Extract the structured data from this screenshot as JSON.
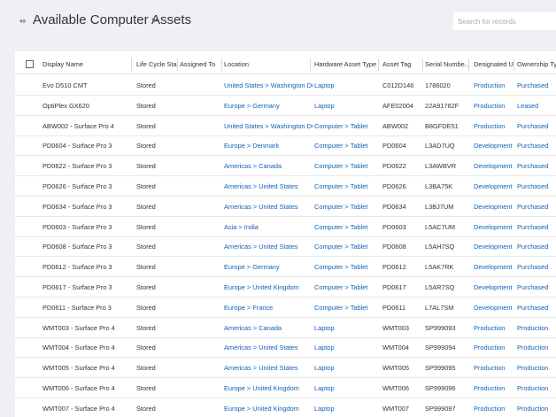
{
  "header": {
    "title": "Available Computer Assets",
    "search_placeholder": "Search for records"
  },
  "columns": [
    "Display Name",
    "Life Cycle Sta...",
    "Assigned To",
    "Location",
    "Hardware Asset Type",
    "Asset Tag",
    "Serial Numbe...",
    "Designated U...",
    "Ownership Ty..."
  ],
  "rows": [
    {
      "name": "Evo D510 CMT",
      "status": "Stored",
      "assigned": "",
      "location": "United States > Washington DC",
      "type": "Laptop",
      "tag": "C012D146",
      "serial": "1786020",
      "use": "Production",
      "ownership": "Purchased"
    },
    {
      "name": "OptiPlex GX620",
      "status": "Stored",
      "assigned": "",
      "location": "Europe > Germany",
      "type": "Laptop",
      "tag": "AFE02004",
      "serial": "22A91782F",
      "use": "Production",
      "ownership": "Leased"
    },
    {
      "name": "ABW002 - Surface Pro 4",
      "status": "Stored",
      "assigned": "",
      "location": "United States > Washington DC ...",
      "type": "Computer > Tablet",
      "tag": "ABW002",
      "serial": "B8GFDE51",
      "use": "Production",
      "ownership": "Purchased"
    },
    {
      "name": "PD0604 - Surface Pro 3",
      "status": "Stored",
      "assigned": "",
      "location": "Europe > Denmark",
      "type": "Computer > Tablet",
      "tag": "PD0604",
      "serial": "L3AD7UQ",
      "use": "Development",
      "ownership": "Purchased"
    },
    {
      "name": "PD0622 - Surface Pro 3",
      "status": "Stored",
      "assigned": "",
      "location": "Americas > Canada",
      "type": "Computer > Tablet",
      "tag": "PD0622",
      "serial": "L3AWBVR",
      "use": "Development",
      "ownership": "Purchased"
    },
    {
      "name": "PD0626 - Surface Pro 3",
      "status": "Stored",
      "assigned": "",
      "location": "Americas > United States",
      "type": "Computer > Tablet",
      "tag": "PD0626",
      "serial": "L3BA75K",
      "use": "Development",
      "ownership": "Purchased"
    },
    {
      "name": "PD0634 - Surface Pro 3",
      "status": "Stored",
      "assigned": "",
      "location": "Americas > United States",
      "type": "Computer > Tablet",
      "tag": "PD0634",
      "serial": "L3BJ7UM",
      "use": "Development",
      "ownership": "Purchased"
    },
    {
      "name": "PD0603 - Surface Pro 3",
      "status": "Stored",
      "assigned": "",
      "location": "Asia > India",
      "type": "Computer > Tablet",
      "tag": "PD0603",
      "serial": "L5AC7UM",
      "use": "Development",
      "ownership": "Purchased"
    },
    {
      "name": "PD0608 - Surface Pro 3",
      "status": "Stored",
      "assigned": "",
      "location": "Americas > United States",
      "type": "Computer > Tablet",
      "tag": "PD0608",
      "serial": "L5AH7SQ",
      "use": "Development",
      "ownership": "Purchased"
    },
    {
      "name": "PD0612 - Surface Pro 3",
      "status": "Stored",
      "assigned": "",
      "location": "Europe > Germany",
      "type": "Computer > Tablet",
      "tag": "PD0612",
      "serial": "L5AK7RK",
      "use": "Development",
      "ownership": "Purchased"
    },
    {
      "name": "PD0617 - Surface Pro 3",
      "status": "Stored",
      "assigned": "",
      "location": "Europe > United Kingdom",
      "type": "Computer > Tablet",
      "tag": "PD0617",
      "serial": "L5AR7SQ",
      "use": "Development",
      "ownership": "Purchased"
    },
    {
      "name": "PD0611 - Surface Pro 3",
      "status": "Stored",
      "assigned": "",
      "location": "Europe > France",
      "type": "Computer > Tablet",
      "tag": "PD0611",
      "serial": "L7AL7SM",
      "use": "Development",
      "ownership": "Purchased"
    },
    {
      "name": "WMT003 - Surface Pro 4",
      "status": "Stored",
      "assigned": "",
      "location": "Americas > Canada",
      "type": "Laptop",
      "tag": "WMT003",
      "serial": "SP999093",
      "use": "Production",
      "ownership": "Production"
    },
    {
      "name": "WMT004 - Surface Pro 4",
      "status": "Stored",
      "assigned": "",
      "location": "Americas > United States",
      "type": "Laptop",
      "tag": "WMT004",
      "serial": "SP999094",
      "use": "Production",
      "ownership": "Production"
    },
    {
      "name": "WMT005 - Surface Pro 4",
      "status": "Stored",
      "assigned": "",
      "location": "Americas > United States",
      "type": "Laptop",
      "tag": "WMT005",
      "serial": "SP999095",
      "use": "Production",
      "ownership": "Production"
    },
    {
      "name": "WMT006 - Surface Pro 4",
      "status": "Stored",
      "assigned": "",
      "location": "Europe > United Kingdom",
      "type": "Laptop",
      "tag": "WMT006",
      "serial": "SP999096",
      "use": "Production",
      "ownership": "Production"
    },
    {
      "name": "WMT007 - Surface Pro 4",
      "status": "Stored",
      "assigned": "",
      "location": "Europe > United Kingdom",
      "type": "Laptop",
      "tag": "WMT007",
      "serial": "SP999097",
      "use": "Production",
      "ownership": "Production"
    }
  ]
}
